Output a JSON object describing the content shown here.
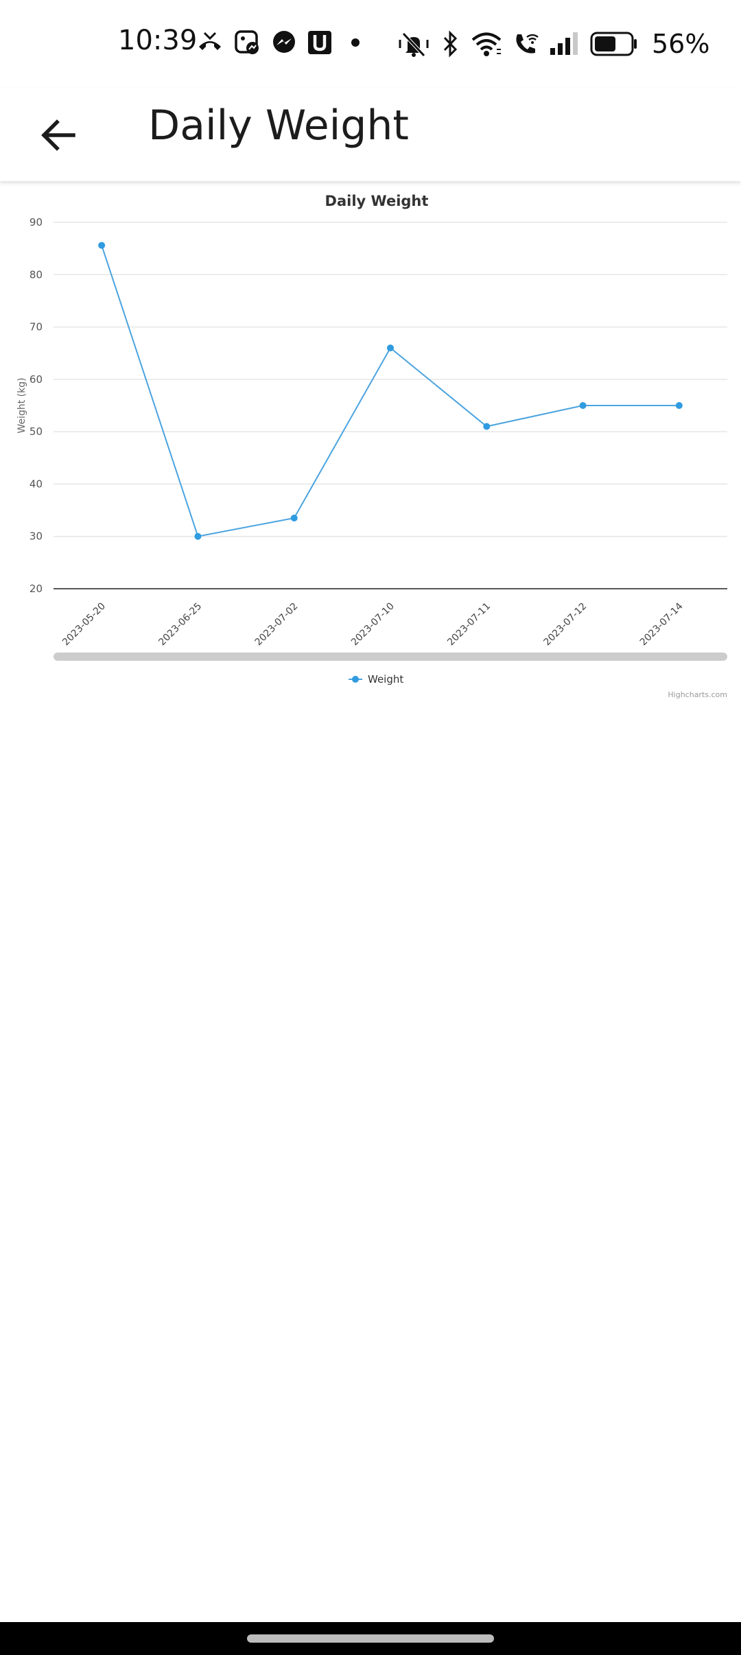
{
  "status_bar": {
    "time": "10:39",
    "battery_percent": "56%",
    "left_icons": [
      "missed-call-icon",
      "messenger-photo-icon",
      "messenger-icon",
      "u-app-icon",
      "dot-icon"
    ],
    "right_icons": [
      "mute-vibrate-icon",
      "bluetooth-icon",
      "wifi-icon",
      "wifi-call-icon",
      "signal-icon",
      "battery-icon"
    ]
  },
  "app_bar": {
    "title": "Daily Weight",
    "back_icon": "arrow-left-icon"
  },
  "chart_data": {
    "type": "line",
    "title": "Daily Weight",
    "ylabel": "Weight (kg)",
    "xlabel": "",
    "categories": [
      "2023-05-20",
      "2023-06-25",
      "2023-07-02",
      "2023-07-10",
      "2023-07-11",
      "2023-07-12",
      "2023-07-14"
    ],
    "series": [
      {
        "name": "Weight",
        "values": [
          85.6,
          30,
          33.5,
          66,
          51,
          55,
          55
        ]
      }
    ],
    "ylim": [
      20,
      90
    ],
    "yticks": [
      20,
      30,
      40,
      50,
      60,
      70,
      80,
      90
    ],
    "grid": true,
    "legend": "bottom-center",
    "credits": "Highcharts.com",
    "colors": {
      "series": "#4aa3df",
      "marker": "#2f9be0",
      "grid": "#e6e6e6",
      "axis": "#555555",
      "scrollbar": "#cccccc"
    }
  }
}
